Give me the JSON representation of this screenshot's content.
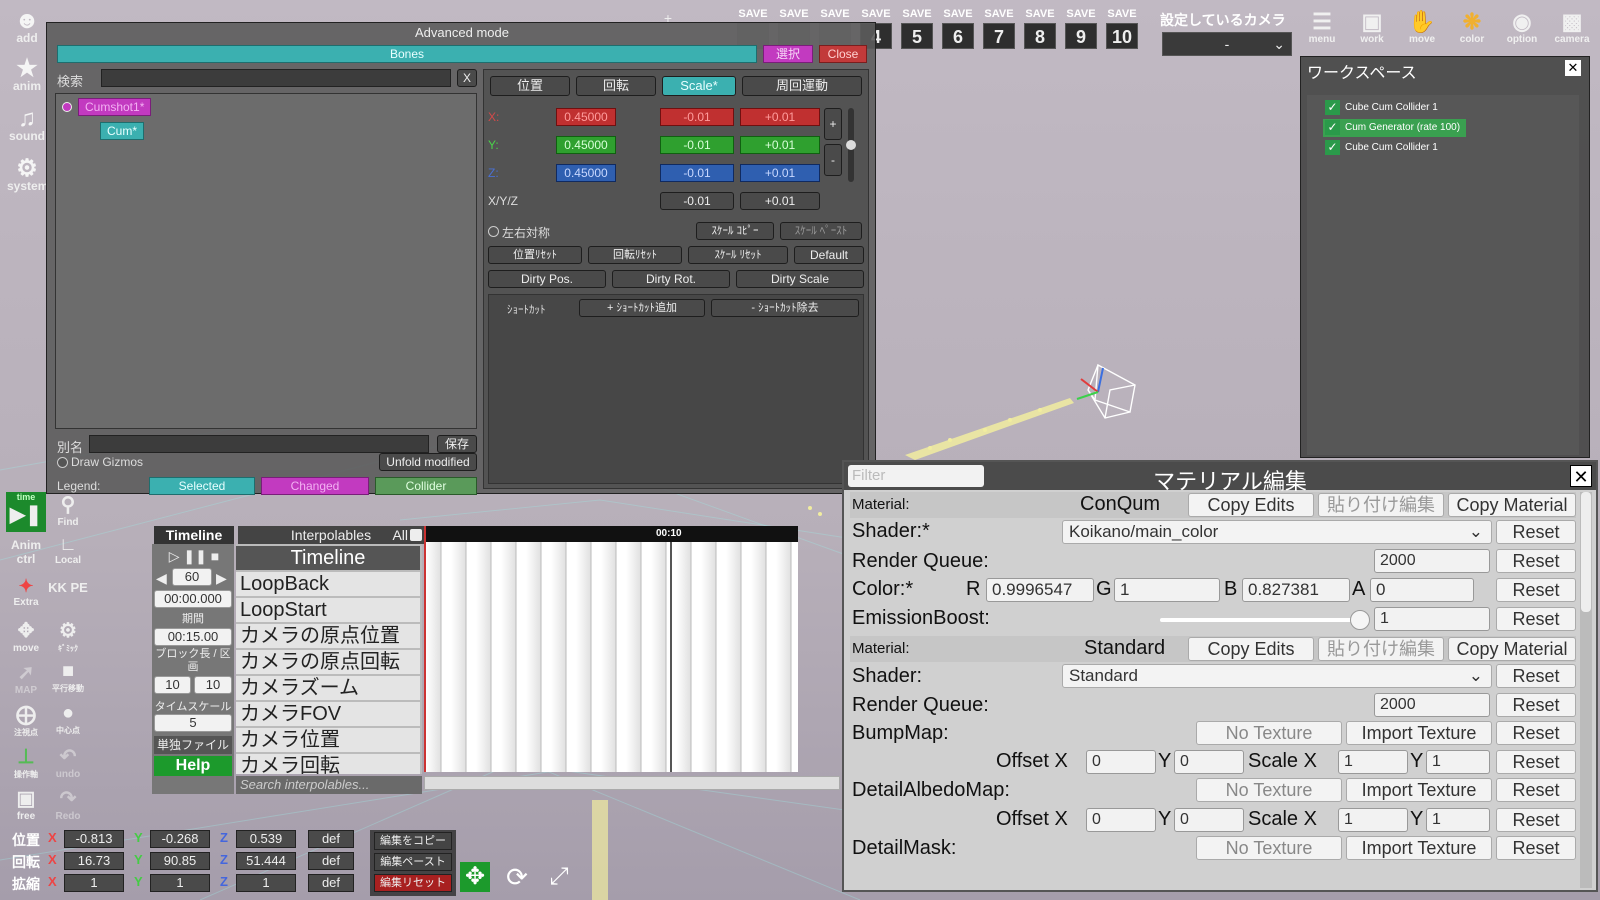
{
  "left_toolbar": [
    {
      "label": "add",
      "icon": "person-add-icon"
    },
    {
      "label": "anim",
      "icon": "running-person-icon"
    },
    {
      "label": "sound",
      "icon": "music-note-icon"
    },
    {
      "label": "system",
      "icon": "gears-icon"
    }
  ],
  "save_slots": {
    "label": "SAVE",
    "numbers": [
      "4",
      "5",
      "6",
      "7",
      "8",
      "9",
      "10"
    ]
  },
  "camera_select": {
    "label": "設定しているカメラ",
    "value": "-"
  },
  "top_right": [
    {
      "label": "menu",
      "icon": "menu-icon"
    },
    {
      "label": "work",
      "icon": "work-window-icon"
    },
    {
      "label": "move",
      "icon": "hand-icon"
    },
    {
      "label": "color",
      "icon": "palette-icon"
    },
    {
      "label": "option",
      "icon": "eye-icon"
    },
    {
      "label": "camera",
      "icon": "camera-icon"
    }
  ],
  "workspace": {
    "title": "ワークスペース",
    "close": "✕",
    "items": [
      "Cube Cum Collider 1",
      "Cum Generator (rate 100)",
      "Cube Cum Collider 1"
    ]
  },
  "advanced": {
    "title": "Advanced mode",
    "tab": "Bones",
    "tab_pink": "選択",
    "close": "Close",
    "search_label": "検索",
    "search_clear": "X",
    "tree": [
      "Cumshot1*",
      "Cum*"
    ],
    "alias_label": "別名",
    "save_label": "保存",
    "draw_gizmos": "Draw Gizmos",
    "unfold": "Unfold modified",
    "legend_label": "Legend:",
    "legend": [
      "Selected",
      "Changed",
      "Collider"
    ],
    "tabs": [
      "位置",
      "回転",
      "Scale*",
      "周回運動"
    ],
    "axes": [
      "X:",
      "Y:",
      "Z:"
    ],
    "values": [
      "0.45000",
      "0.45000",
      "0.45000"
    ],
    "minus": "-0.01",
    "plus": "+0.01",
    "xyz_label": "X/Y/Z",
    "plus_sign": "+",
    "minus_sign": "-",
    "mirror": "左右対称",
    "scale_copy": "ｽｹｰﾙ ｺﾋﾟｰ",
    "scale_paste": "ｽｹｰﾙ ﾍﾟｰｽﾄ",
    "resets": [
      "位置ﾘｾｯﾄ",
      "回転ﾘｾｯﾄ",
      "ｽｹｰﾙ ﾘｾｯﾄ",
      "Default"
    ],
    "dirty": [
      "Dirty Pos.",
      "Dirty Rot.",
      "Dirty Scale"
    ],
    "shortcut": "ｼｮｰﾄｶｯﾄ",
    "add_shortcut": "+ ｼｮｰﾄｶｯﾄ追加",
    "remove_shortcut": "- ｼｮｰﾄｶｯﾄ除去"
  },
  "side_tools": [
    {
      "label": "time",
      "icon": "play-pause-icon"
    },
    {
      "label": "Find",
      "icon": "magnifier-icon"
    },
    {
      "label": "Anim ctrl",
      "icon": "anim-ctrl-icon"
    },
    {
      "label": "Local",
      "icon": "local-axis-icon"
    },
    {
      "label": "Extra",
      "icon": "extra-icon"
    },
    {
      "label": "KK PE",
      "icon": "kkpe-icon"
    },
    {
      "label": "move",
      "icon": "move-arrows-icon"
    },
    {
      "label": "ｷﾞﾐｯｸ",
      "icon": "gear-icon"
    },
    {
      "label": "MAP",
      "icon": "map-icon"
    },
    {
      "label": "平行移動",
      "icon": "square-icon"
    },
    {
      "label": "注視点",
      "icon": "crosshair-icon"
    },
    {
      "label": "中心点",
      "icon": "circle-icon"
    },
    {
      "label": "操作軸",
      "icon": "axis-icon"
    },
    {
      "label": "undo",
      "icon": "undo-icon"
    },
    {
      "label": "free",
      "icon": "movie-camera-icon"
    },
    {
      "label": "Redo",
      "icon": "redo-icon"
    }
  ],
  "timeline": {
    "title": "Timeline",
    "interpolables": "Interpolables",
    "all": "All",
    "fps": "60",
    "time": "00:00.000",
    "duration_label": "期間",
    "duration": "00:15.00",
    "block_label": "ブロック長 / 区画",
    "block_a": "10",
    "block_b": "10",
    "timescale_label": "タイムスケール",
    "timescale": "5",
    "single_file": "単独ファイル",
    "help": "Help",
    "items": [
      "Timeline",
      "LoopBack",
      "LoopStart",
      "カメラの原点位置",
      "カメラの原点回転",
      "カメラズーム",
      "カメラFOV",
      "カメラ位置",
      "カメラ回転"
    ],
    "search_placeholder": "Search interpolables...",
    "marker": "00:10"
  },
  "transform": {
    "rows": [
      {
        "label": "位置",
        "x": "-0.813",
        "y": "-0.268",
        "z": "0.539"
      },
      {
        "label": "回転",
        "x": "16.73",
        "y": "90.85",
        "z": "51.444"
      },
      {
        "label": "拡縮",
        "x": "1",
        "y": "1",
        "z": "1"
      }
    ],
    "axis_x": "X",
    "axis_y": "Y",
    "axis_z": "Z",
    "def": "def",
    "copy_edit": "編集をコピー",
    "paste_edit": "編集ペースト",
    "reset_edit": "編集リセット"
  },
  "material": {
    "title": "マテリアル編集",
    "filter_placeholder": "Filter",
    "close": "✕",
    "mat1": {
      "label": "Material:",
      "name": "ConQum"
    },
    "copy_edits": "Copy Edits",
    "paste_edits": "貼り付け編集",
    "copy_material": "Copy Material",
    "shader1": {
      "label": "Shader:*",
      "value": "Koikano/main_color"
    },
    "reset": "Reset",
    "rq_label": "Render Queue:",
    "rq1": "2000",
    "color_label": "Color:*",
    "r": "0.9996547",
    "g": "1",
    "b": "0.827381",
    "a": "0",
    "r_lbl": "R",
    "g_lbl": "G",
    "b_lbl": "B",
    "a_lbl": "A",
    "emission_label": "EmissionBoost:",
    "emission": "1",
    "emission_level": 0.95,
    "mat2": {
      "label": "Material:",
      "name": "Standard"
    },
    "shader2": {
      "label": "Shader:",
      "value": "Standard"
    },
    "rq2": "2000",
    "bump": "BumpMap:",
    "detail_albedo": "DetailAlbedoMap:",
    "detail_mask": "DetailMask:",
    "no_texture": "No Texture",
    "import_texture": "Import Texture",
    "offset_x": "Offset X",
    "y": "Y",
    "scale_x": "Scale X",
    "zero": "0",
    "one": "1"
  }
}
